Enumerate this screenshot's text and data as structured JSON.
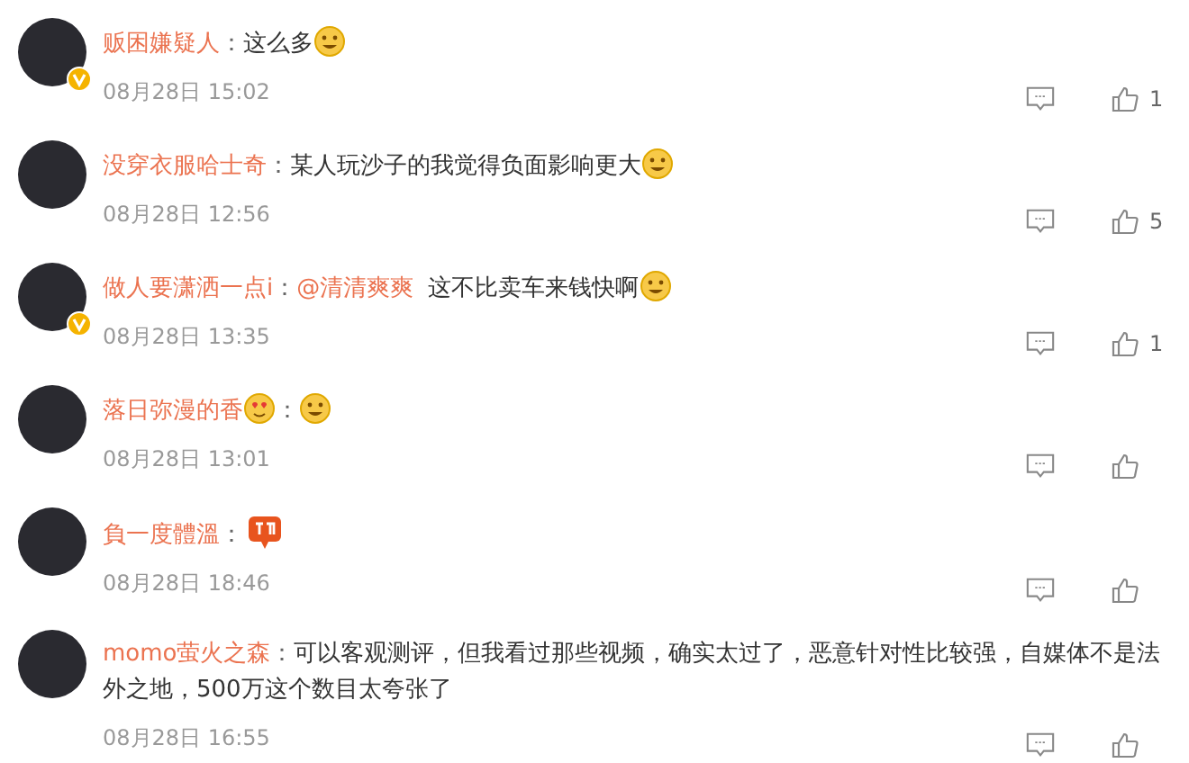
{
  "comments": [
    {
      "name": "贩困嫌疑人",
      "separator": "：",
      "verified": true,
      "content": [
        {
          "kind": "text",
          "text": "这么多"
        },
        {
          "kind": "emoji"
        }
      ],
      "time": "08月28日 15:02",
      "likes": "1"
    },
    {
      "name": "没穿衣服哈士奇",
      "separator": "：",
      "verified": false,
      "content": [
        {
          "kind": "text",
          "text": "某人玩沙子的我觉得负面影响更大"
        },
        {
          "kind": "emoji"
        }
      ],
      "time": "08月28日 12:56",
      "likes": "5"
    },
    {
      "name": "做人要潇洒一点i",
      "separator": "：",
      "verified": true,
      "content": [
        {
          "kind": "mention",
          "text": "@清清爽爽"
        },
        {
          "kind": "text",
          "text": "这不比卖车来钱快啊"
        },
        {
          "kind": "emoji"
        }
      ],
      "time": "08月28日 13:35",
      "likes": "1"
    },
    {
      "name": "落日弥漫的香",
      "separator": "：",
      "verified": false,
      "name_emoji": true,
      "content": [
        {
          "kind": "emoji"
        }
      ],
      "time": "08月28日 13:01"
    },
    {
      "name": "負一度體溫",
      "separator": "：",
      "verified": false,
      "content": [
        {
          "kind": "sticker"
        }
      ],
      "time": "08月28日 18:46"
    },
    {
      "name": "momo萤火之森",
      "separator": "：",
      "verified": false,
      "content": [
        {
          "kind": "text",
          "text": "可以客观测评，但我看过那些视频，确实太过了，恶意针对性比较强，自媒体不是法外之地，500万这个数目太夸张了"
        }
      ],
      "time": "08月28日 16:55"
    }
  ]
}
